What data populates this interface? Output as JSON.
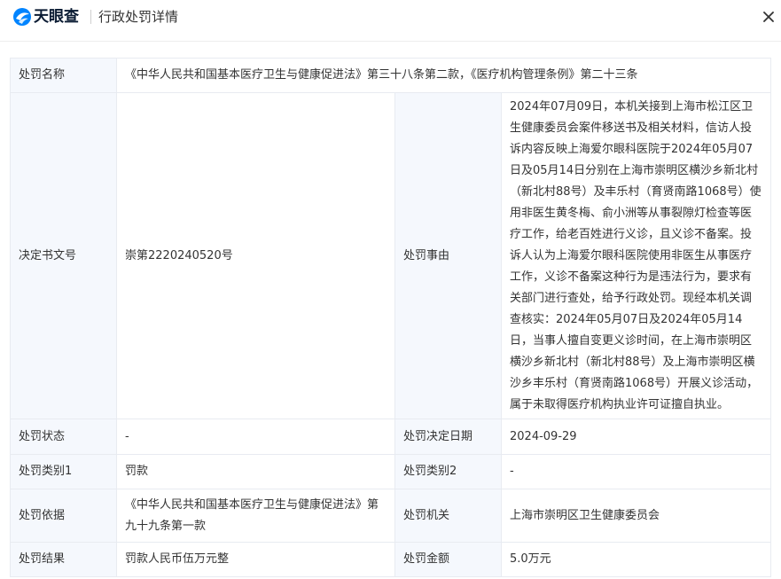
{
  "header": {
    "logo_text": "天眼查",
    "title": "行政处罚详情",
    "close_icon": "close-icon"
  },
  "detail": {
    "name_label": "处罚名称",
    "name_value": "《中华人民共和国基本医疗卫生与健康促进法》第三十八条第二款，《医疗机构管理条例》第二十三条",
    "doc_no_label": "决定书文号",
    "doc_no_value": "崇第2220240520号",
    "reason_label": "处罚事由",
    "reason_value": "2024年07月09日，本机关接到上海市松江区卫生健康委员会案件移送书及相关材料，信访人投诉内容反映上海爱尔眼科医院于2024年05月07日及05月14日分别在上海市崇明区横沙乡新北村（新北村88号）及丰乐村（育贤南路1068号）使用非医生黄冬梅、俞小洲等从事裂隙灯检查等医疗工作，给老百姓进行义诊，且义诊不备案。投诉人认为上海爱尔眼科医院使用非医生从事医疗工作，义诊不备案这种行为是违法行为，要求有关部门进行查处，给予行政处罚。现经本机关调查核实：2024年05月07日及2024年05月14日，当事人擅自变更义诊时间，在上海市崇明区横沙乡新北村（新北村88号）及上海市崇明区横沙乡丰乐村（育贤南路1068号）开展义诊活动，属于未取得医疗机构执业许可证擅自执业。",
    "status_label": "处罚状态",
    "status_value": "-",
    "date_label": "处罚决定日期",
    "date_value": "2024-09-29",
    "cat1_label": "处罚类别1",
    "cat1_value": "罚款",
    "cat2_label": "处罚类别2",
    "cat2_value": "-",
    "basis_label": "处罚依据",
    "basis_value": "《中华人民共和国基本医疗卫生与健康促进法》第九十九条第一款",
    "org_label": "处罚机关",
    "org_value": "上海市崇明区卫生健康委员会",
    "result_label": "处罚结果",
    "result_value": "罚款人民币伍万元整",
    "amount_label": "处罚金额",
    "amount_value": "5.0万元"
  }
}
